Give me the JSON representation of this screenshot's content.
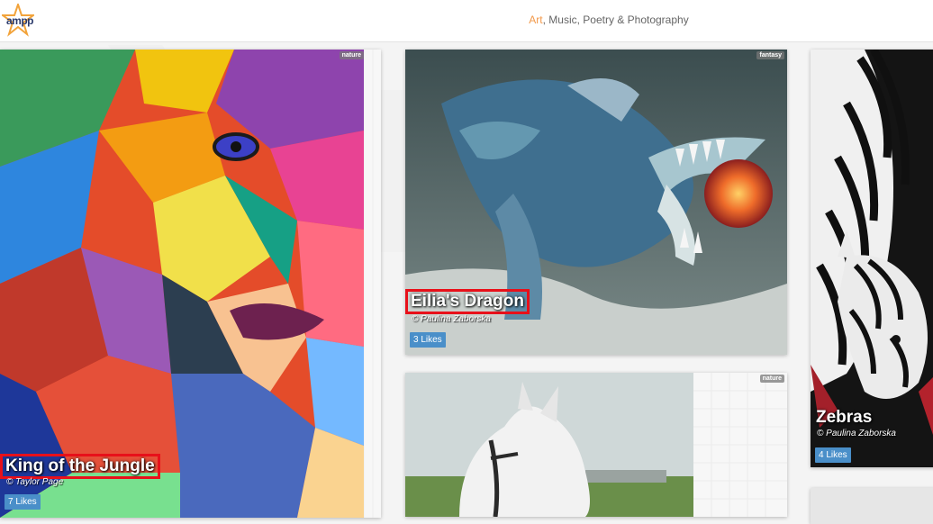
{
  "header": {
    "logo_text": "ampp",
    "tagline_accent": "Art",
    "tagline_rest": ", Music, Poetry & Photography"
  },
  "cards": [
    {
      "title": "King of the Jungle",
      "credit": "© Taylor Page",
      "likes": "7 Likes",
      "tag": "nature",
      "highlighted": true
    },
    {
      "title": "Eilia's Dragon",
      "credit": "© Paulina Zaborska",
      "likes": "3 Likes",
      "tag": "fantasy",
      "highlighted": true
    },
    {
      "title": "Zebras",
      "credit": "© Paulina Zaborska",
      "likes": "4 Likes",
      "tag": "",
      "highlighted": false
    },
    {
      "title": "",
      "credit": "",
      "likes": "",
      "tag": "nature",
      "highlighted": false
    }
  ],
  "colors": {
    "accent": "#f2994a",
    "likes_badge": "#4a8fc9",
    "highlight_box": "#e8101a"
  }
}
